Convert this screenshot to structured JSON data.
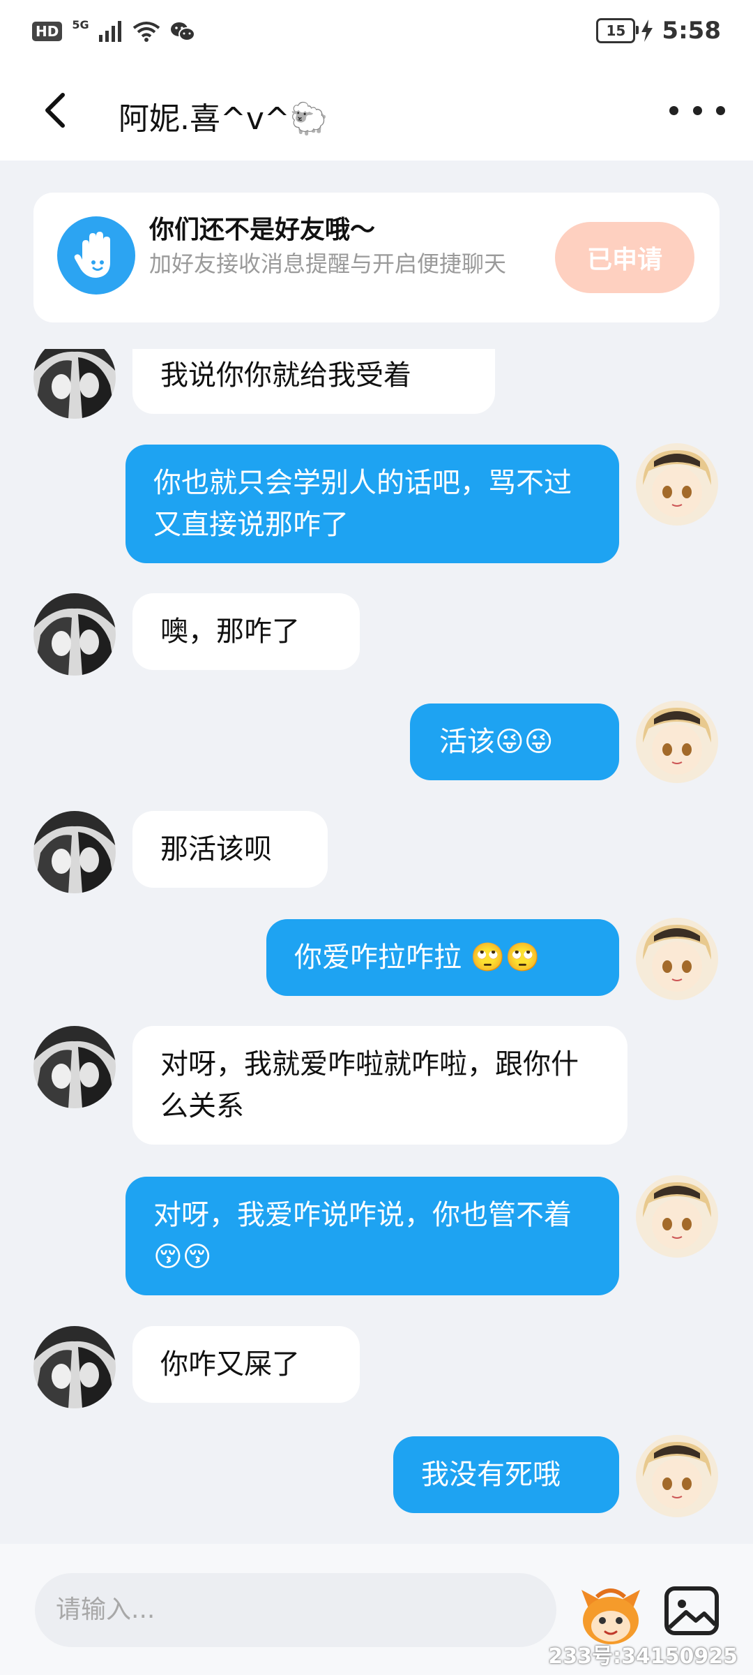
{
  "status_bar": {
    "hd": "HD",
    "network": "5G",
    "battery": "15",
    "time": "5:58"
  },
  "header": {
    "title": "阿妮.喜^v^🐑"
  },
  "banner": {
    "title": "你们还不是好友哦～",
    "description": "加好友接收消息提醒与开启便捷聊天",
    "button": "已申请"
  },
  "messages": [
    {
      "side": "in",
      "text": "我说你你就给我受着"
    },
    {
      "side": "out",
      "text": "你也就只会学别人的话吧，骂不过又直接说那咋了"
    },
    {
      "side": "in",
      "text": "噢，那咋了"
    },
    {
      "side": "out",
      "text": "活该😜😜"
    },
    {
      "side": "in",
      "text": "那活该呗"
    },
    {
      "side": "out",
      "text": "你爱咋拉咋拉 🙄🙄"
    },
    {
      "side": "in",
      "text": "对呀，我就爱咋啦就咋啦，跟你什么关系"
    },
    {
      "side": "out",
      "text": "对呀，我爱咋说咋说，你也管不着😚😚"
    },
    {
      "side": "in",
      "text": "你咋又屎了"
    },
    {
      "side": "out",
      "text": "我没有死哦"
    }
  ],
  "input": {
    "placeholder": "请输入..."
  },
  "watermark": "233号:34150925",
  "colors": {
    "outgoing_bubble": "#1ea3f2",
    "incoming_bubble": "#ffffff",
    "apply_button": "#fed0c0",
    "hand_icon_bg": "#2ca4f2"
  },
  "icons": {
    "back": "chevron-left-icon",
    "more": "more-dots-icon",
    "hand": "hand-wave-icon",
    "sticker": "sticker-icon",
    "image": "image-icon"
  }
}
